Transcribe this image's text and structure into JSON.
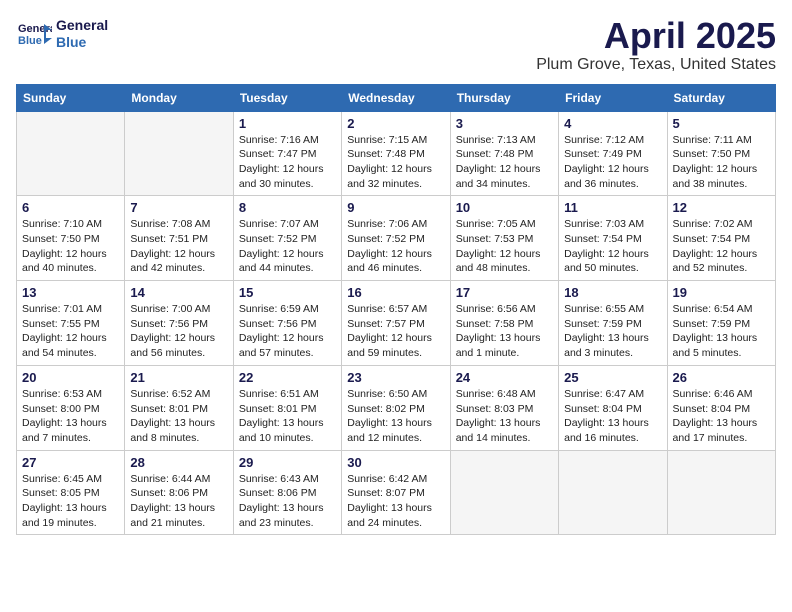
{
  "header": {
    "logo_line1": "General",
    "logo_line2": "Blue",
    "title": "April 2025",
    "subtitle": "Plum Grove, Texas, United States"
  },
  "weekdays": [
    "Sunday",
    "Monday",
    "Tuesday",
    "Wednesday",
    "Thursday",
    "Friday",
    "Saturday"
  ],
  "weeks": [
    [
      {
        "day": "",
        "info": ""
      },
      {
        "day": "",
        "info": ""
      },
      {
        "day": "1",
        "info": "Sunrise: 7:16 AM\nSunset: 7:47 PM\nDaylight: 12 hours\nand 30 minutes."
      },
      {
        "day": "2",
        "info": "Sunrise: 7:15 AM\nSunset: 7:48 PM\nDaylight: 12 hours\nand 32 minutes."
      },
      {
        "day": "3",
        "info": "Sunrise: 7:13 AM\nSunset: 7:48 PM\nDaylight: 12 hours\nand 34 minutes."
      },
      {
        "day": "4",
        "info": "Sunrise: 7:12 AM\nSunset: 7:49 PM\nDaylight: 12 hours\nand 36 minutes."
      },
      {
        "day": "5",
        "info": "Sunrise: 7:11 AM\nSunset: 7:50 PM\nDaylight: 12 hours\nand 38 minutes."
      }
    ],
    [
      {
        "day": "6",
        "info": "Sunrise: 7:10 AM\nSunset: 7:50 PM\nDaylight: 12 hours\nand 40 minutes."
      },
      {
        "day": "7",
        "info": "Sunrise: 7:08 AM\nSunset: 7:51 PM\nDaylight: 12 hours\nand 42 minutes."
      },
      {
        "day": "8",
        "info": "Sunrise: 7:07 AM\nSunset: 7:52 PM\nDaylight: 12 hours\nand 44 minutes."
      },
      {
        "day": "9",
        "info": "Sunrise: 7:06 AM\nSunset: 7:52 PM\nDaylight: 12 hours\nand 46 minutes."
      },
      {
        "day": "10",
        "info": "Sunrise: 7:05 AM\nSunset: 7:53 PM\nDaylight: 12 hours\nand 48 minutes."
      },
      {
        "day": "11",
        "info": "Sunrise: 7:03 AM\nSunset: 7:54 PM\nDaylight: 12 hours\nand 50 minutes."
      },
      {
        "day": "12",
        "info": "Sunrise: 7:02 AM\nSunset: 7:54 PM\nDaylight: 12 hours\nand 52 minutes."
      }
    ],
    [
      {
        "day": "13",
        "info": "Sunrise: 7:01 AM\nSunset: 7:55 PM\nDaylight: 12 hours\nand 54 minutes."
      },
      {
        "day": "14",
        "info": "Sunrise: 7:00 AM\nSunset: 7:56 PM\nDaylight: 12 hours\nand 56 minutes."
      },
      {
        "day": "15",
        "info": "Sunrise: 6:59 AM\nSunset: 7:56 PM\nDaylight: 12 hours\nand 57 minutes."
      },
      {
        "day": "16",
        "info": "Sunrise: 6:57 AM\nSunset: 7:57 PM\nDaylight: 12 hours\nand 59 minutes."
      },
      {
        "day": "17",
        "info": "Sunrise: 6:56 AM\nSunset: 7:58 PM\nDaylight: 13 hours\nand 1 minute."
      },
      {
        "day": "18",
        "info": "Sunrise: 6:55 AM\nSunset: 7:59 PM\nDaylight: 13 hours\nand 3 minutes."
      },
      {
        "day": "19",
        "info": "Sunrise: 6:54 AM\nSunset: 7:59 PM\nDaylight: 13 hours\nand 5 minutes."
      }
    ],
    [
      {
        "day": "20",
        "info": "Sunrise: 6:53 AM\nSunset: 8:00 PM\nDaylight: 13 hours\nand 7 minutes."
      },
      {
        "day": "21",
        "info": "Sunrise: 6:52 AM\nSunset: 8:01 PM\nDaylight: 13 hours\nand 8 minutes."
      },
      {
        "day": "22",
        "info": "Sunrise: 6:51 AM\nSunset: 8:01 PM\nDaylight: 13 hours\nand 10 minutes."
      },
      {
        "day": "23",
        "info": "Sunrise: 6:50 AM\nSunset: 8:02 PM\nDaylight: 13 hours\nand 12 minutes."
      },
      {
        "day": "24",
        "info": "Sunrise: 6:48 AM\nSunset: 8:03 PM\nDaylight: 13 hours\nand 14 minutes."
      },
      {
        "day": "25",
        "info": "Sunrise: 6:47 AM\nSunset: 8:04 PM\nDaylight: 13 hours\nand 16 minutes."
      },
      {
        "day": "26",
        "info": "Sunrise: 6:46 AM\nSunset: 8:04 PM\nDaylight: 13 hours\nand 17 minutes."
      }
    ],
    [
      {
        "day": "27",
        "info": "Sunrise: 6:45 AM\nSunset: 8:05 PM\nDaylight: 13 hours\nand 19 minutes."
      },
      {
        "day": "28",
        "info": "Sunrise: 6:44 AM\nSunset: 8:06 PM\nDaylight: 13 hours\nand 21 minutes."
      },
      {
        "day": "29",
        "info": "Sunrise: 6:43 AM\nSunset: 8:06 PM\nDaylight: 13 hours\nand 23 minutes."
      },
      {
        "day": "30",
        "info": "Sunrise: 6:42 AM\nSunset: 8:07 PM\nDaylight: 13 hours\nand 24 minutes."
      },
      {
        "day": "",
        "info": ""
      },
      {
        "day": "",
        "info": ""
      },
      {
        "day": "",
        "info": ""
      }
    ]
  ]
}
